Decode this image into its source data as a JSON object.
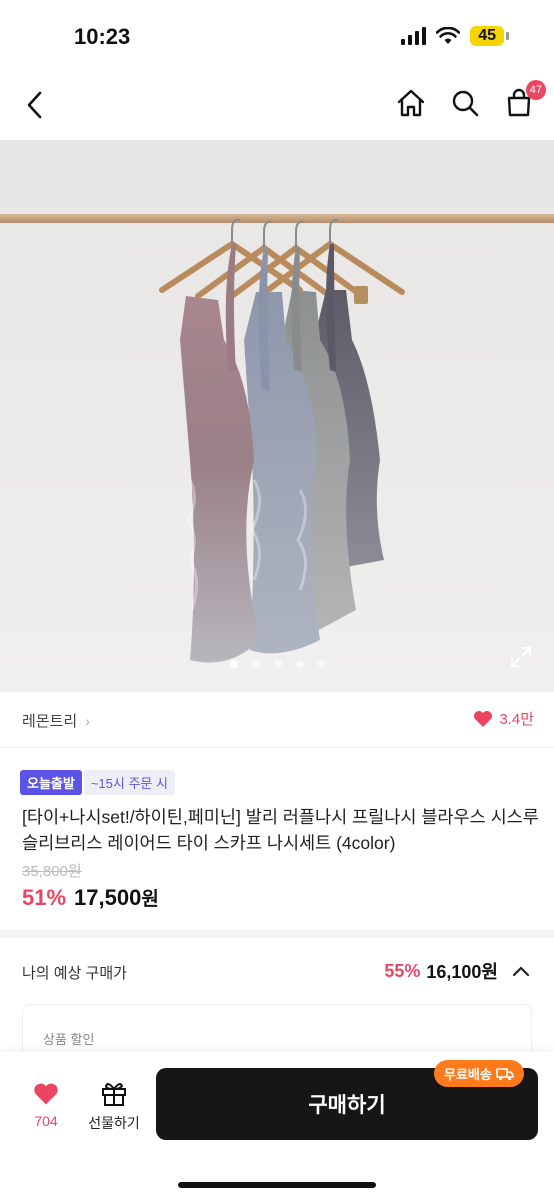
{
  "status_bar": {
    "time": "10:23",
    "battery": "45"
  },
  "nav": {
    "cart_count": "47"
  },
  "gallery": {
    "dots": 5,
    "active_dot": 0
  },
  "brand": {
    "name": "레몬트리",
    "likes": "3.4만"
  },
  "product": {
    "tag_today": "오늘출발",
    "tag_order": "~15시 주문 시",
    "title": "[타이+나시set!/하이틴,페미닌] 발리 러플나시 프릴나시 블라우스 시스루 슬리브리스 레이어드 타이 스카프 나시세트 (4color)",
    "original_price": "35,800원",
    "discount_rate": "51%",
    "price": "17,500",
    "price_unit": "원"
  },
  "expected": {
    "label": "나의 예상 구매가",
    "discount_rate": "55%",
    "price": "16,100원"
  },
  "discount_box": {
    "label": "상품 할인"
  },
  "bottom": {
    "like_count": "704",
    "gift_label": "선물하기",
    "buy_label": "구매하기",
    "free_shipping": "무료배송"
  },
  "colors": {
    "accent": "#ec4561",
    "tag_purple": "#5b53e6",
    "ship_orange": "#ff7a1a"
  }
}
